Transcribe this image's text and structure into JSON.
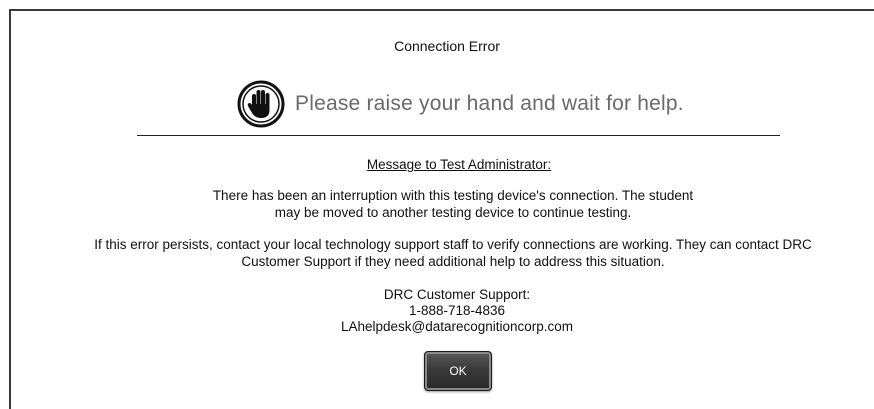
{
  "dialog": {
    "title": "Connection Error",
    "raise_hand_text": "Please raise your hand and wait for help.",
    "message_heading": "Message to Test Administrator:",
    "paragraph1_line1": "There has been an interruption with this testing device's connection. The student",
    "paragraph1_line2": "may be moved to another testing device to continue testing.",
    "paragraph2_line1": "If this error persists, contact your local technology support staff to verify connections are working. They can contact DRC",
    "paragraph2_line2": "Customer Support if they need additional help to address this situation.",
    "support_label": "DRC Customer Support:",
    "support_phone": "1-888-718-4836",
    "support_email": "LAhelpdesk@datarecognitioncorp.com",
    "ok_label": "OK"
  },
  "icons": {
    "hand": "raised-hand-icon"
  },
  "colors": {
    "border": "#3a3a3a",
    "raise_text": "#6a6a6a",
    "button_bg": "#3a3a3a",
    "button_text": "#ffffff"
  }
}
